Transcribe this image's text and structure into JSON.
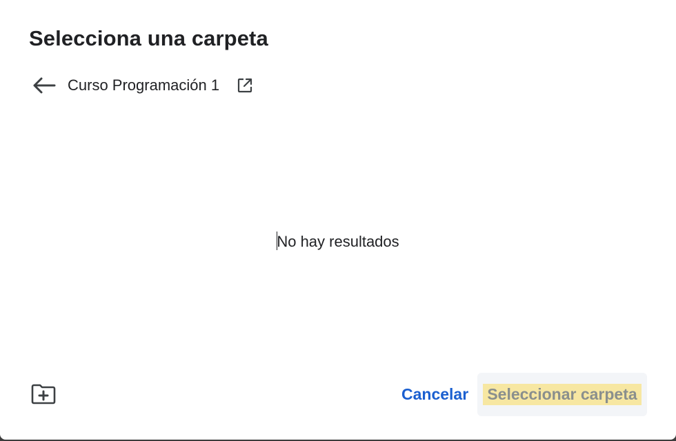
{
  "dialog": {
    "title": "Selecciona una carpeta",
    "folder_name": "Curso Programación 1",
    "empty_message": "No hay resultados",
    "cancel_label": "Cancelar",
    "select_label": "Seleccionar carpeta"
  },
  "icons": {
    "back": "arrow-back-icon",
    "open_new": "open-in-new-icon",
    "new_folder": "create-new-folder-icon"
  },
  "colors": {
    "accent": "#1a5fd0",
    "text": "#202124",
    "disabled_text": "#8a8f8d",
    "highlight": "#f7e7a2"
  }
}
